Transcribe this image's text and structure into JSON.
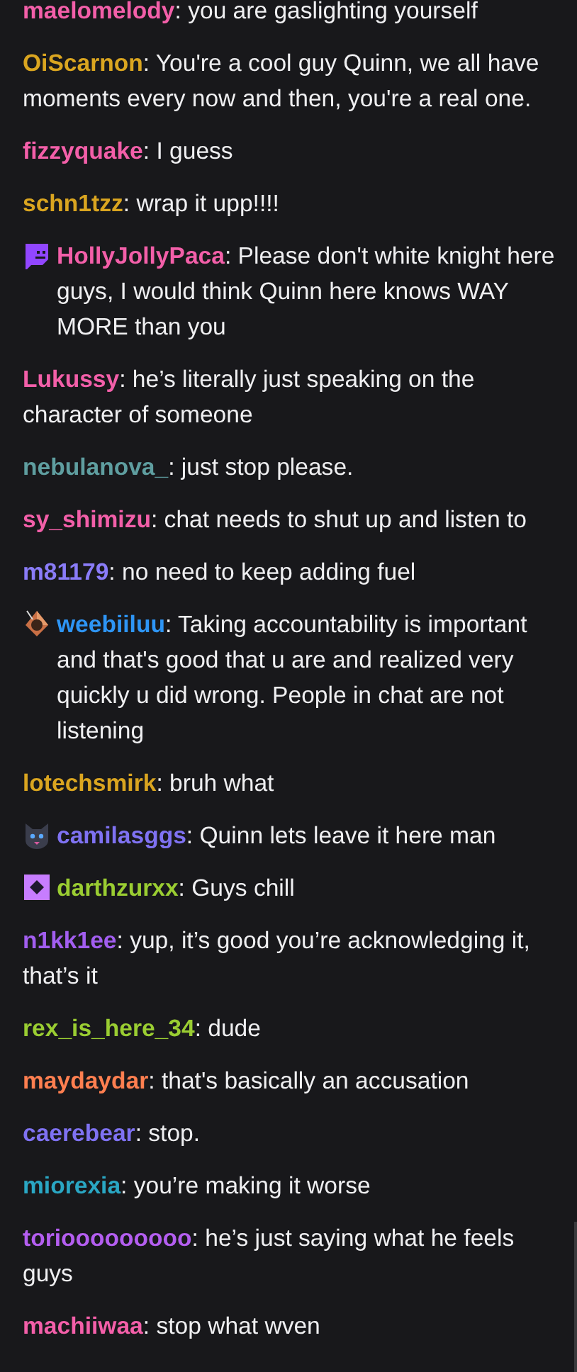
{
  "chat": {
    "messages": [
      {
        "user": "maelomelody",
        "color": "#f35fa9",
        "text": ": you are gaslighting yourself"
      },
      {
        "user": "OiScarnon",
        "color": "#daa520",
        "text": ": You're a cool guy Quinn, we all have moments every now and then, you're a real one."
      },
      {
        "user": "fizzyquake",
        "color": "#f35fa9",
        "text": ": I guess"
      },
      {
        "user": "schn1tzz",
        "color": "#daa520",
        "text": ": wrap it upp!!!!"
      },
      {
        "user": "HollyJollyPaca",
        "color": "#f35fa9",
        "badge": {
          "kind": "glitch"
        },
        "text": ": Please don't white knight here guys, I would think Quinn here knows WAY MORE than you"
      },
      {
        "user": "Lukussy",
        "color": "#f35fa9",
        "text": ": he’s literally just speaking on the character of someone"
      },
      {
        "user": "nebulanova_",
        "color": "#5f9ea0",
        "text": ": just stop please."
      },
      {
        "user": "sy_shimizu",
        "color": "#f35fa9",
        "text": ": chat needs to shut up and listen to"
      },
      {
        "user": "m81179",
        "color": "#8a7cf8",
        "text": ": no need to keep adding fuel"
      },
      {
        "user": "weebiiluu",
        "color": "#2e95f5",
        "badge": {
          "kind": "gem"
        },
        "text": ": Taking accountability is important and that's good that u are and realized very quickly u did wrong. People in chat are not listening"
      },
      {
        "user": "lotechsmirk",
        "color": "#daa520",
        "text": ": bruh what"
      },
      {
        "user": "camilasggs",
        "color": "#7f72f2",
        "badge": {
          "kind": "cat"
        },
        "text": ": Quinn lets leave it here man"
      },
      {
        "user": "darthzurxx",
        "color": "#9acd32",
        "badge": {
          "kind": "diamond"
        },
        "text": ": Guys chill"
      },
      {
        "user": "n1kk1ee",
        "color": "#a25ef0",
        "text": ": yup, it’s good you’re acknowledging it, that’s it"
      },
      {
        "user": "rex_is_here_34",
        "color": "#9acd32",
        "text": ": dude"
      },
      {
        "user": "maydaydar",
        "color": "#ff7f50",
        "text": ": that's basically an accusation"
      },
      {
        "user": "caerebear",
        "color": "#7f72f2",
        "text": ": stop."
      },
      {
        "user": "miorexia",
        "color": "#2aa7c4",
        "text": ": you’re making it worse"
      },
      {
        "user": "toriooooooooo",
        "color": "#b45ef0",
        "text": ": he’s just saying what he feels guys"
      },
      {
        "user": "machiiwaa",
        "color": "#f35fa9",
        "text": ": stop what wven"
      }
    ]
  }
}
